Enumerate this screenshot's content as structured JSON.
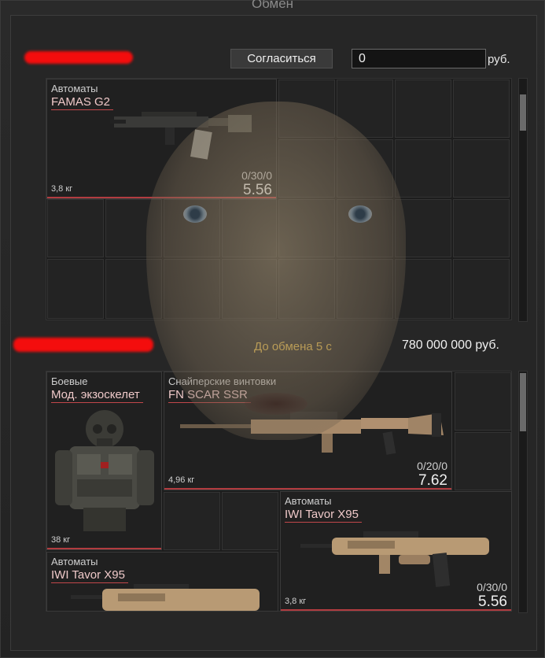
{
  "window": {
    "title": "Обмен"
  },
  "my_side": {
    "agree_label": "Согласиться",
    "money_value": "0",
    "currency": "руб.",
    "items": [
      {
        "category": "Автоматы",
        "name": "FAMAS G2",
        "weight": "3,8 кг",
        "ammo": "0/30/0",
        "price": "5.56"
      }
    ]
  },
  "partner_side": {
    "timer_text": "До обмена 5 с",
    "money_text": "780 000 000 руб.",
    "items": [
      {
        "category": "Боевые",
        "name": "Мод. экзоскелет",
        "weight": "38 кг"
      },
      {
        "category": "Снайперские винтовки",
        "name": "FN SCAR SSR",
        "weight": "4,96 кг",
        "ammo": "0/20/0",
        "price": "7.62"
      },
      {
        "category": "Автоматы",
        "name": "IWI Tavor X95",
        "weight": "3,8 кг",
        "ammo": "0/30/0",
        "price": "5.56"
      },
      {
        "category": "Автоматы",
        "name": "IWI Tavor X95"
      }
    ]
  },
  "colors": {
    "accent": "#c2474b",
    "timer": "#e3b94a",
    "redaction": "#f40d0d"
  },
  "icons": [
    "famas-g2-rifle-icon",
    "exoskeleton-armor-icon",
    "scar-ssr-rifle-icon",
    "tavor-x95-rifle-icon"
  ]
}
